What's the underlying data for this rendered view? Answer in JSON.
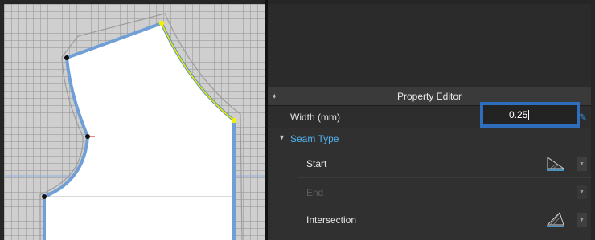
{
  "property_editor": {
    "title": "Property Editor",
    "pin_icon": "pin-arrow-icon"
  },
  "width": {
    "label": "Width (mm)",
    "value": "0.25"
  },
  "seam_type": {
    "label": "Seam Type",
    "rows": [
      {
        "label": "Start",
        "enabled": true
      },
      {
        "label": "End",
        "enabled": false
      },
      {
        "label": "Intersection",
        "enabled": true
      }
    ]
  },
  "colors": {
    "highlight_border": "#2f6dbd",
    "seam_line": "#6f9fd6",
    "selected_edge": "#e5e800",
    "section_label": "#4fb3f0"
  }
}
